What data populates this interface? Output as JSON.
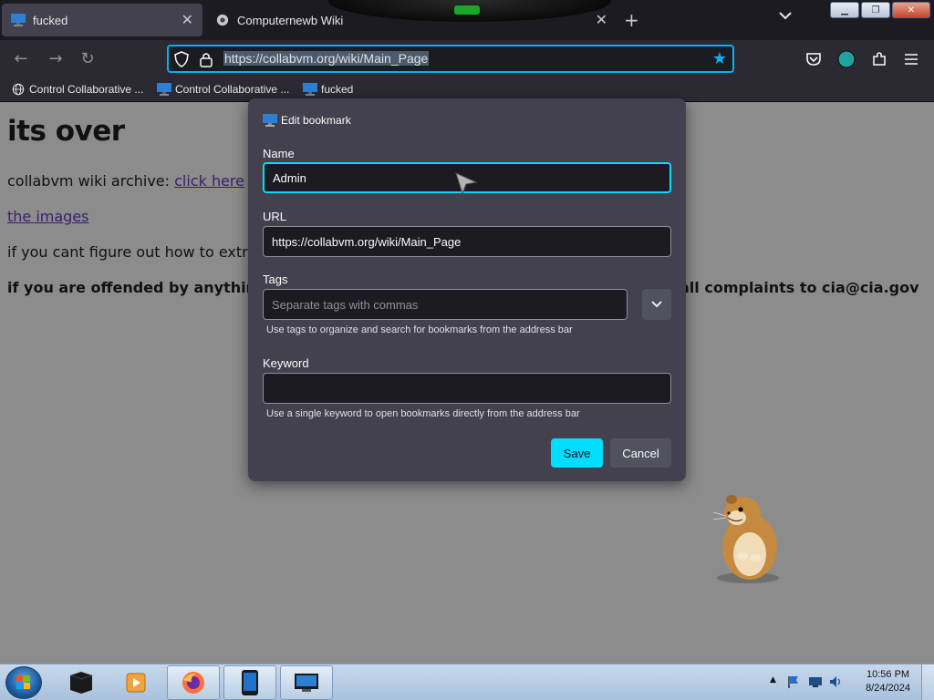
{
  "tabs": [
    {
      "title": "fucked",
      "icon": "monitor-icon",
      "active": true
    },
    {
      "title": "Computernewb Wiki",
      "icon": "wiki-favicon-icon",
      "active": false
    }
  ],
  "toolbar": {
    "url": "https://collabvm.org/wiki/Main_Page"
  },
  "bookmarks": [
    {
      "label": "Control Collaborative ...",
      "icon": "globe-icon"
    },
    {
      "label": "Control Collaborative ...",
      "icon": "monitor-icon"
    },
    {
      "label": "fucked",
      "icon": "monitor-icon"
    }
  ],
  "page": {
    "title": "its over",
    "archive_text": "collabvm wiki archive: ",
    "archive_link": "click here",
    "images_link": "the images",
    "extract_text": "if you cant figure out how to extrac",
    "offended_text": "if you are offended by anything i",
    "complaints_text": "all complaints to cia@cia.gov"
  },
  "dialog": {
    "title": "Edit bookmark",
    "name_label": "Name",
    "name_value": "Admin",
    "url_label": "URL",
    "url_value": "https://collabvm.org/wiki/Main_Page",
    "tags_label": "Tags",
    "tags_placeholder": "Separate tags with commas",
    "tags_hint": "Use tags to organize and search for bookmarks from the address bar",
    "keyword_label": "Keyword",
    "keyword_value": "",
    "keyword_hint": "Use a single keyword to open bookmarks directly from the address bar",
    "save_label": "Save",
    "cancel_label": "Cancel"
  },
  "taskbar": {
    "time": "10:56 PM",
    "date": "8/24/2024"
  },
  "colors": {
    "accent": "#00ddff",
    "dialog_bg": "#42414d",
    "page_bg": "#8c8c8c"
  }
}
